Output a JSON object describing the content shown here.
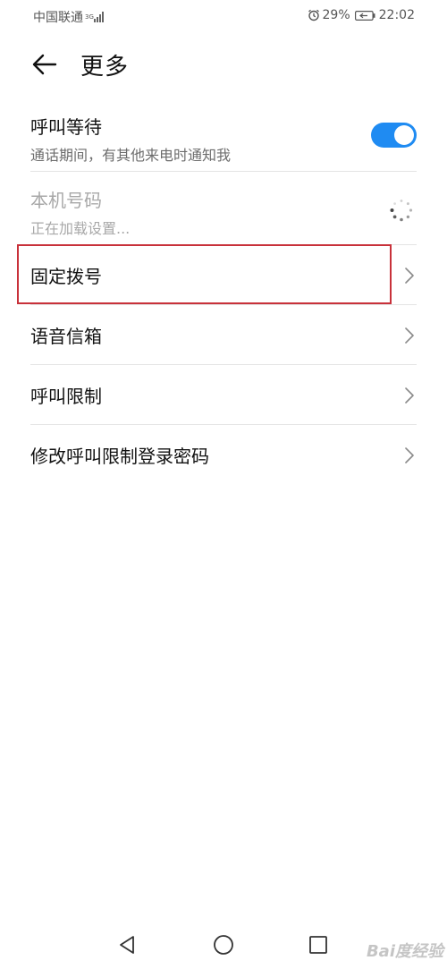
{
  "status_bar": {
    "carrier": "中国联通",
    "network_type": "3G",
    "battery_percent": "29%",
    "time": "22:02",
    "signal_bars": 4
  },
  "header": {
    "title": "更多",
    "back_icon": "arrow-left-icon"
  },
  "settings": {
    "call_waiting": {
      "title": "呼叫等待",
      "subtitle": "通话期间，有其他来电时通知我",
      "toggle_on": true
    },
    "my_number": {
      "title": "本机号码",
      "subtitle": "正在加载设置..."
    },
    "items": [
      {
        "label": "固定拨号"
      },
      {
        "label": "语音信箱"
      },
      {
        "label": "呼叫限制"
      },
      {
        "label": "修改呼叫限制登录密码"
      }
    ]
  },
  "nav_bar": {
    "back_icon": "triangle-back-icon",
    "home_icon": "circle-home-icon",
    "recent_icon": "square-recent-icon"
  },
  "watermark": "Bai度经验",
  "colors": {
    "accent": "#1f8bf2",
    "highlight_border": "#c8313a",
    "divider": "#e4e4e4"
  }
}
